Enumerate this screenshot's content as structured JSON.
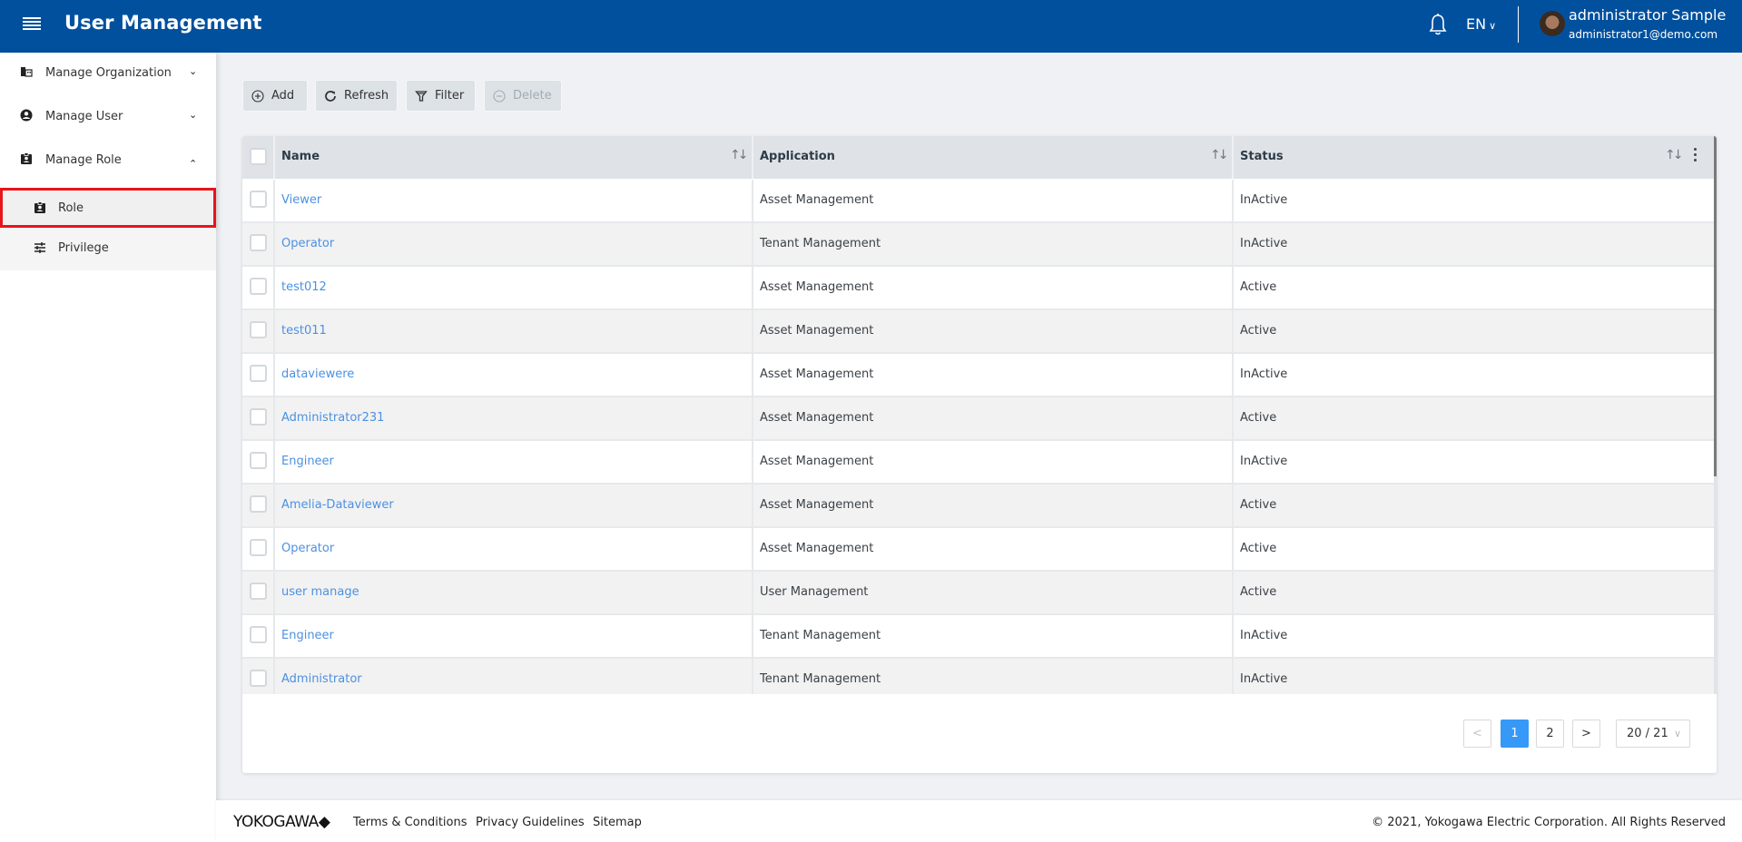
{
  "header": {
    "title": "User Management",
    "language": "EN",
    "user_name": "administrator Sample",
    "user_email": "administrator1@demo.com",
    "bg_color": "#00509e"
  },
  "sidebar": {
    "items": [
      {
        "label": "Manage Organization",
        "icon": "organization-icon",
        "expanded": false
      },
      {
        "label": "Manage User",
        "icon": "account-circle-icon",
        "expanded": false
      },
      {
        "label": "Manage Role",
        "icon": "badge-icon",
        "expanded": true
      }
    ],
    "sub_items": [
      {
        "label": "Role",
        "icon": "badge-icon",
        "selected": true
      },
      {
        "label": "Privilege",
        "icon": "sliders-icon",
        "selected": false
      }
    ]
  },
  "toolbar": {
    "add_label": "Add",
    "refresh_label": "Refresh",
    "filter_label": "Filter",
    "delete_label": "Delete"
  },
  "table": {
    "columns": [
      "Name",
      "Application",
      "Status"
    ],
    "rows": [
      {
        "name": "Viewer",
        "application": "Asset Management",
        "status": "InActive"
      },
      {
        "name": "Operator",
        "application": "Tenant Management",
        "status": "InActive"
      },
      {
        "name": "test012",
        "application": "Asset Management",
        "status": "Active"
      },
      {
        "name": "test011",
        "application": "Asset Management",
        "status": "Active"
      },
      {
        "name": "dataviewere",
        "application": "Asset Management",
        "status": "InActive"
      },
      {
        "name": "Administrator231",
        "application": "Asset Management",
        "status": "Active"
      },
      {
        "name": "Engineer",
        "application": "Asset Management",
        "status": "InActive"
      },
      {
        "name": "Amelia-Dataviewer",
        "application": "Asset Management",
        "status": "Active"
      },
      {
        "name": "Operator",
        "application": "Asset Management",
        "status": "Active"
      },
      {
        "name": "user manage",
        "application": "User Management",
        "status": "Active"
      },
      {
        "name": "Engineer",
        "application": "Tenant Management",
        "status": "InActive"
      },
      {
        "name": "Administrator",
        "application": "Tenant Management",
        "status": "InActive"
      }
    ]
  },
  "pagination": {
    "prev": "<",
    "pages": [
      "1",
      "2"
    ],
    "current_page": "1",
    "next": ">",
    "page_size": "20 / 21"
  },
  "footer": {
    "brand": "YOKOGAWA◆",
    "links": [
      "Terms & Conditions",
      "Privacy Guidelines",
      "Sitemap"
    ],
    "copyright": "© 2021, Yokogawa Electric Corporation. All Rights Reserved"
  }
}
